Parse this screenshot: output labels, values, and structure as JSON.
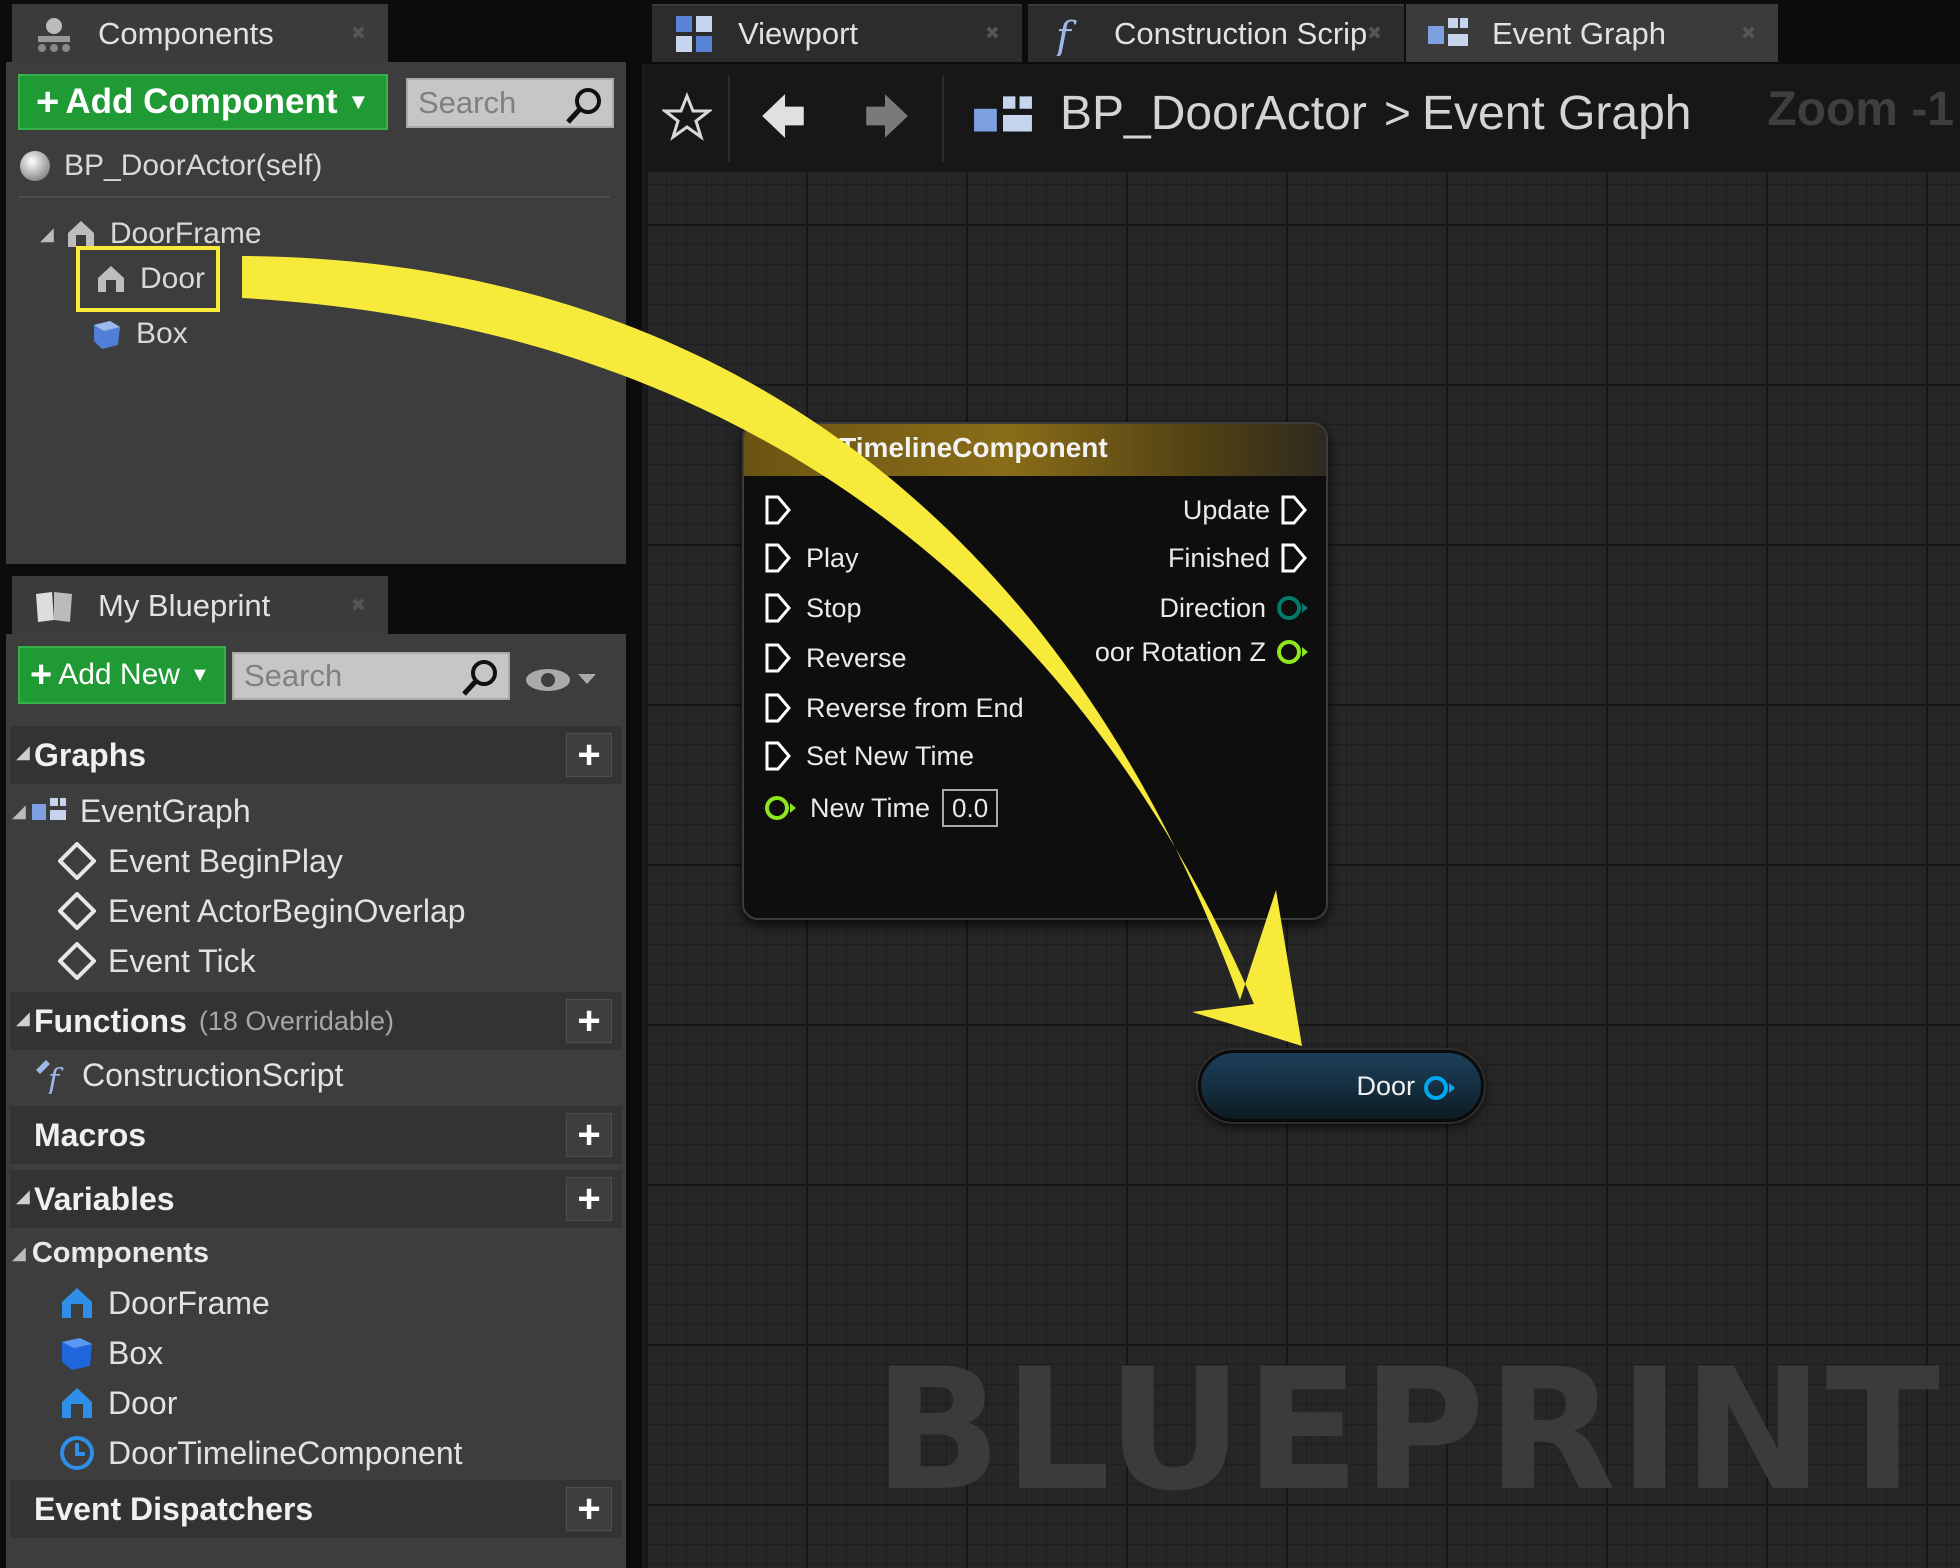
{
  "tabs": {
    "components": "Components",
    "viewport": "Viewport",
    "construction": "Construction Scrip",
    "event_graph": "Event Graph",
    "my_blueprint": "My Blueprint"
  },
  "components_panel": {
    "add_button": "Add Component",
    "search_placeholder": "Search",
    "root": "BP_DoorActor(self)",
    "tree": [
      "DoorFrame",
      "Door",
      "Box"
    ]
  },
  "my_blueprint": {
    "add_button": "Add New",
    "search_placeholder": "Search",
    "sections": {
      "graphs": "Graphs",
      "functions": "Functions",
      "functions_sub": "(18 Overridable)",
      "macros": "Macros",
      "variables": "Variables",
      "components": "Components",
      "event_dispatchers": "Event Dispatchers"
    },
    "event_graph": "EventGraph",
    "events": [
      "Event BeginPlay",
      "Event ActorBeginOverlap",
      "Event Tick"
    ],
    "functions": [
      "ConstructionScript"
    ],
    "components": [
      "DoorFrame",
      "Box",
      "Door",
      "DoorTimelineComponent"
    ]
  },
  "graph": {
    "breadcrumb_root": "BP_DoorActor",
    "breadcrumb_separator": ">",
    "breadcrumb_current": "Event Graph",
    "zoom": "Zoom -1",
    "watermark": "BLUEPRINT",
    "timeline_node": {
      "title": "oorTimelineComponent",
      "inputs": [
        "Play",
        "Stop",
        "Reverse",
        "Reverse from End",
        "Set New Time",
        "New Time"
      ],
      "new_time_value": "0.0",
      "outputs": [
        "Update",
        "Finished",
        "Direction",
        "oor Rotation Z"
      ]
    },
    "variable_node": "Door"
  },
  "colors": {
    "highlight": "#f7ea3a",
    "green_button": "#1f9a34",
    "exec_pin": "#ffffff",
    "float_pin": "#8fe61d",
    "object_pin": "#00a8f3",
    "enum_pin": "#00786a"
  }
}
